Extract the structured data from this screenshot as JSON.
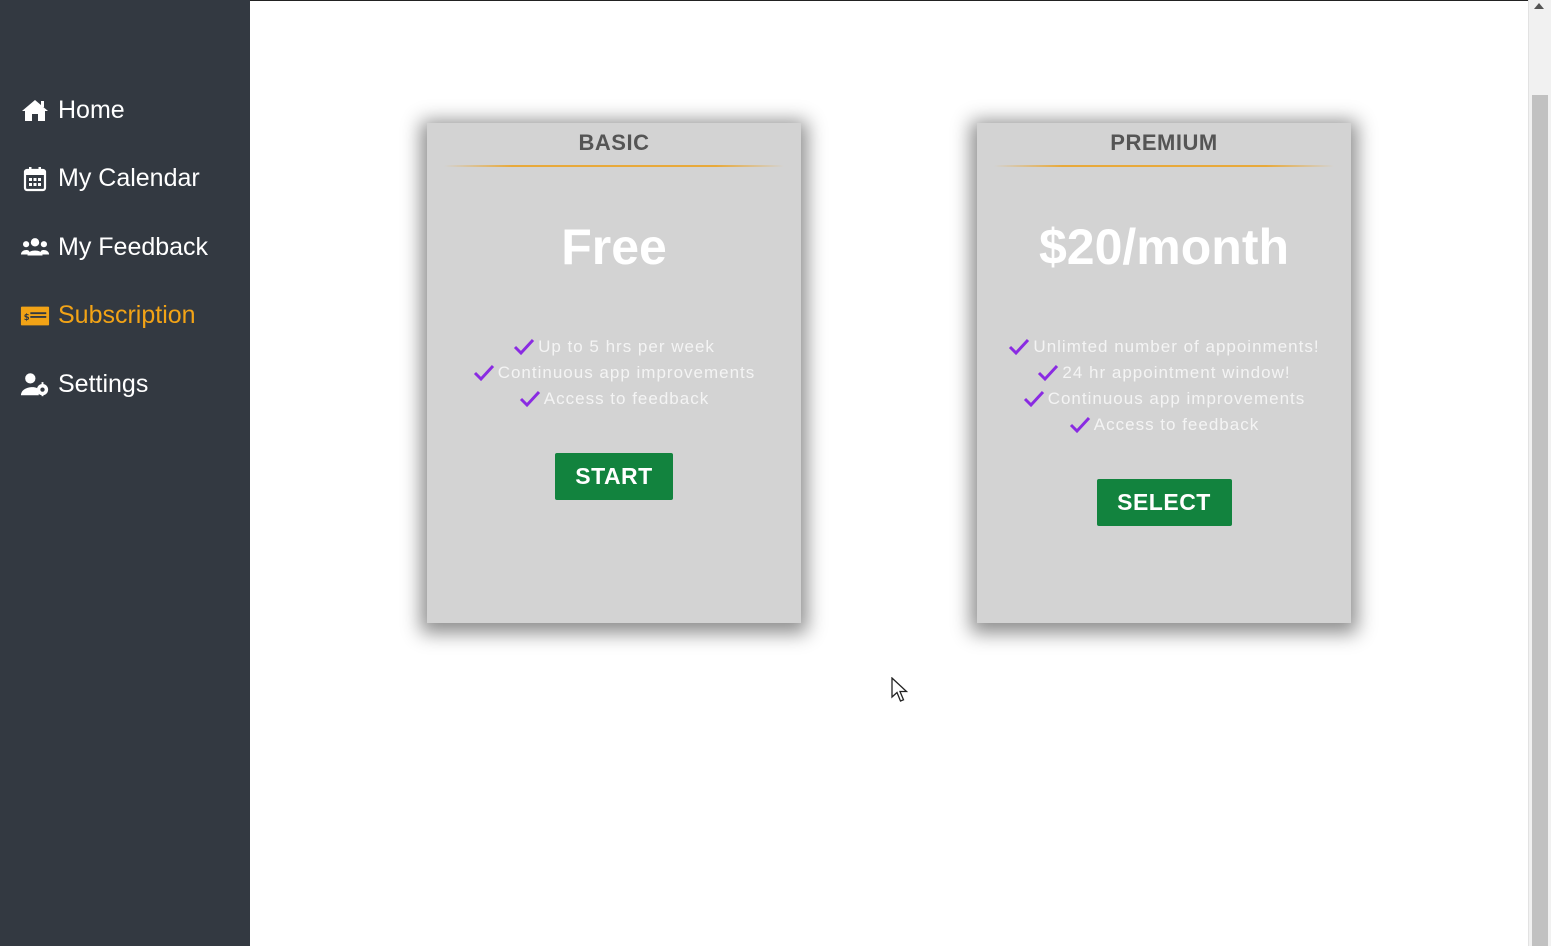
{
  "sidebar": {
    "items": [
      {
        "label": "Home",
        "icon": "home-icon",
        "active": false
      },
      {
        "label": "My Calendar",
        "icon": "calendar-icon",
        "active": false
      },
      {
        "label": "My Feedback",
        "icon": "users-icon",
        "active": false
      },
      {
        "label": "Subscription",
        "icon": "money-card-icon",
        "active": true
      },
      {
        "label": "Settings",
        "icon": "user-gear-icon",
        "active": false
      }
    ]
  },
  "plans": {
    "basic": {
      "title": "BASIC",
      "price": "Free",
      "features": [
        "Up to 5 hrs per week",
        "Continuous app improvements",
        "Access to feedback"
      ],
      "button_label": "START"
    },
    "premium": {
      "title": "PREMIUM",
      "price": "$20/month",
      "features": [
        "Unlimted number of appoinments!",
        "24 hr appointment window!",
        "Continuous app improvements",
        "Access to feedback"
      ],
      "button_label": "SELECT"
    }
  },
  "colors": {
    "sidebar_bg": "#333941",
    "active_nav": "#f2a316",
    "card_bg": "#d3d3d3",
    "button_green": "#12833e",
    "check_purple": "#8a2be2"
  }
}
